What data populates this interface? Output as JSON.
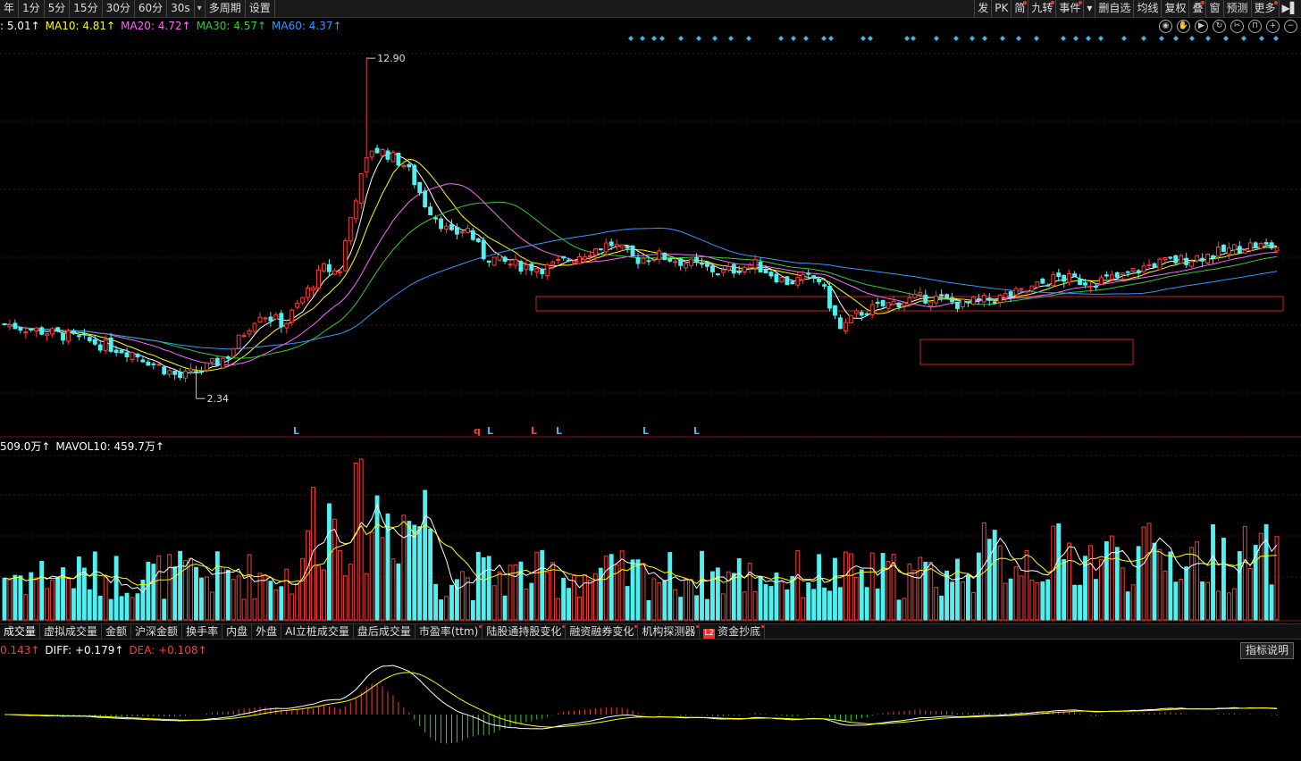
{
  "periods": [
    "年",
    "1分",
    "5分",
    "15分",
    "30分",
    "60分",
    "30s",
    "▾",
    "多周期",
    "设置"
  ],
  "tools": [
    "发",
    "PK",
    "简",
    "九转",
    "事件",
    "▾",
    "删自选",
    "均线",
    "复权",
    "叠",
    "窗",
    "预测",
    "更多",
    "▶▌"
  ],
  "tools_dot": [
    false,
    false,
    true,
    true,
    true,
    false,
    false,
    false,
    false,
    true,
    false,
    false,
    true,
    false
  ],
  "ma_legend": {
    "ma5": ": 5.01↑",
    "ma10": "MA10: 4.81↑",
    "ma20": "MA20: 4.72↑",
    "ma30": "MA30: 4.57↑",
    "ma60": "MA60: 4.37↑"
  },
  "vol_legend": {
    "vol": "509.0万↑",
    "mavol10": "MAVOL10: 459.7万↑"
  },
  "macd_legend": {
    "macd": "0.143↑",
    "diff": "DIFF: +0.179↑",
    "dea": "DEA: +0.108↑"
  },
  "price_labels": {
    "high": "12.90",
    "low": "2.34"
  },
  "markers": [
    "L",
    "q",
    "L",
    "L",
    "L",
    "L",
    "L"
  ],
  "tabs": [
    "成交量",
    "虚拟成交量",
    "金额",
    "沪深金额",
    "换手率",
    "内盘",
    "外盘",
    "AI立桩成交量",
    "盘后成交量",
    "市盈率(ttm)",
    "陆股通持股变化",
    "融资融券变化",
    "机构探测器",
    "资金抄底"
  ],
  "tabs_dot": [
    false,
    false,
    false,
    false,
    false,
    false,
    false,
    false,
    false,
    true,
    true,
    true,
    true,
    true
  ],
  "l2_badge": "L2",
  "explain_label": "指标说明",
  "colors": {
    "up": "#ff3b3b",
    "down": "#4ff0f0",
    "ma5": "#ffffff",
    "ma10": "#ffff00",
    "ma20": "#ff66ff",
    "ma30": "#33cc33",
    "ma60": "#3399ff"
  },
  "icons": [
    "eye-icon",
    "hand-icon",
    "play-icon",
    "replay-icon",
    "scissors-icon",
    "lock-icon",
    "zoom-in-icon",
    "zoom-out-icon"
  ],
  "chart_data": {
    "type": "candlestick",
    "high": 12.9,
    "low": 2.34,
    "ma": {
      "ma5": 5.01,
      "ma10": 4.81,
      "ma20": 4.72,
      "ma30": 4.57,
      "ma60": 4.37
    },
    "volume": {
      "vol_wan": 509.0,
      "mavol10_wan": 459.7
    },
    "macd": {
      "macd": 0.143,
      "diff": 0.179,
      "dea": 0.108
    }
  }
}
